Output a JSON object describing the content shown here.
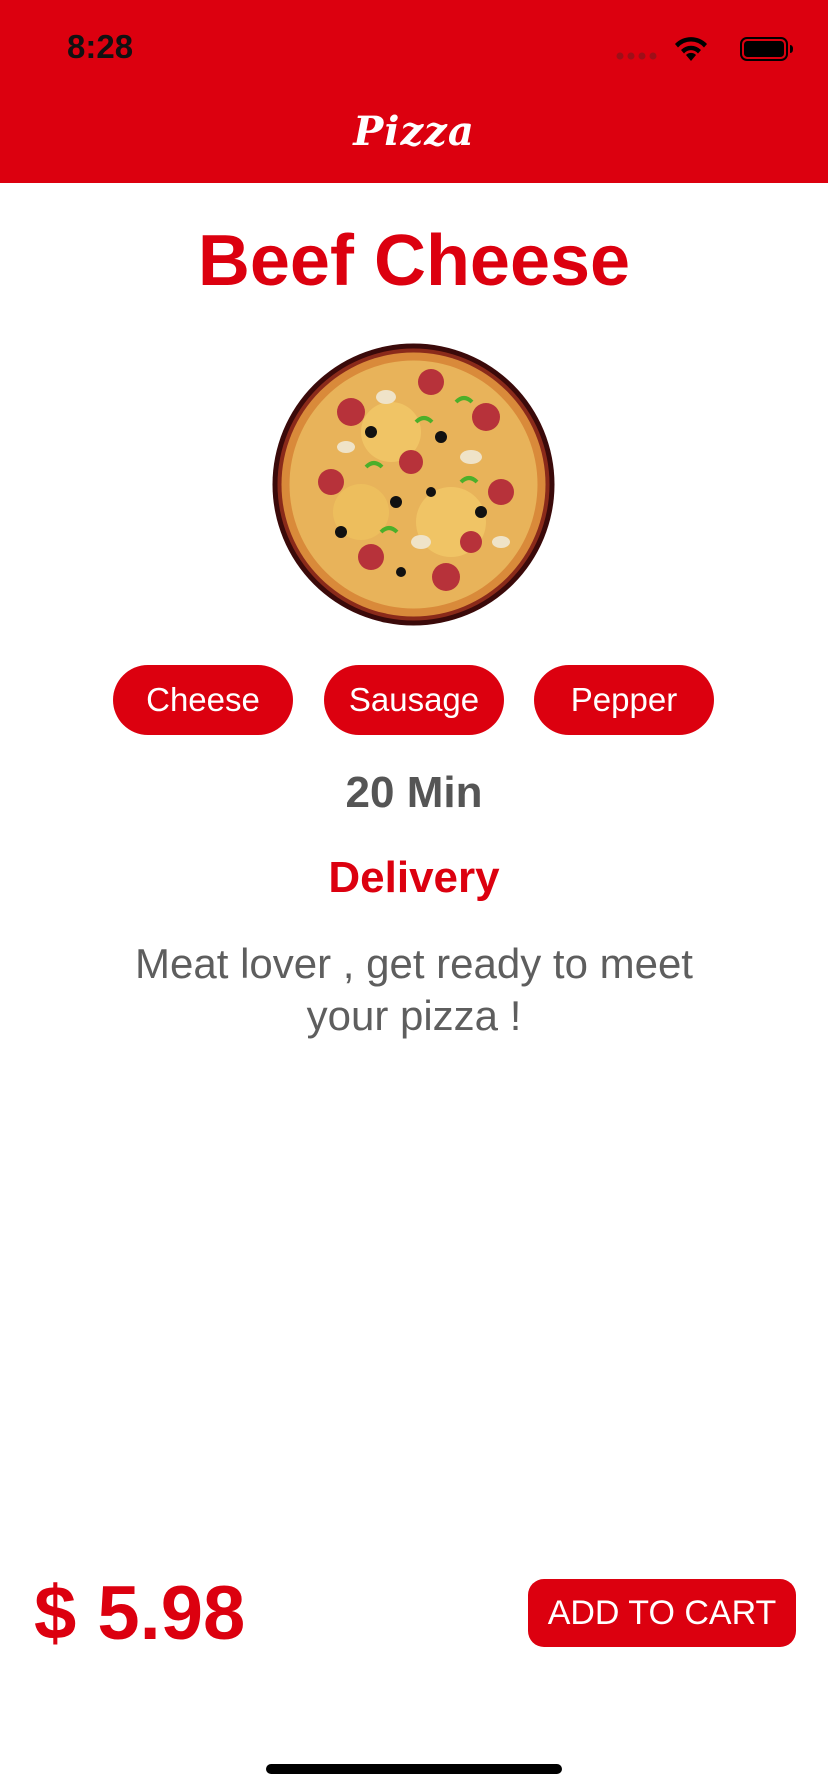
{
  "status_bar": {
    "time": "8:28",
    "icons": [
      "cellular-signal-icon",
      "wifi-icon",
      "battery-icon"
    ]
  },
  "header": {
    "title": "Pizza",
    "background_color": "#dc000f"
  },
  "product": {
    "name": "Beef Cheese",
    "image": "pizza-image",
    "toppings": [
      "Cheese",
      "Sausage",
      "Pepper"
    ],
    "prep_time": "20 Min",
    "delivery_label": "Delivery",
    "description": "Meat lover , get ready to meet your pizza !"
  },
  "footer": {
    "price": "$ 5.98",
    "add_to_cart_label": "ADD TO CART"
  },
  "colors": {
    "accent": "#dc000f",
    "muted_text": "#5e5e5e"
  }
}
